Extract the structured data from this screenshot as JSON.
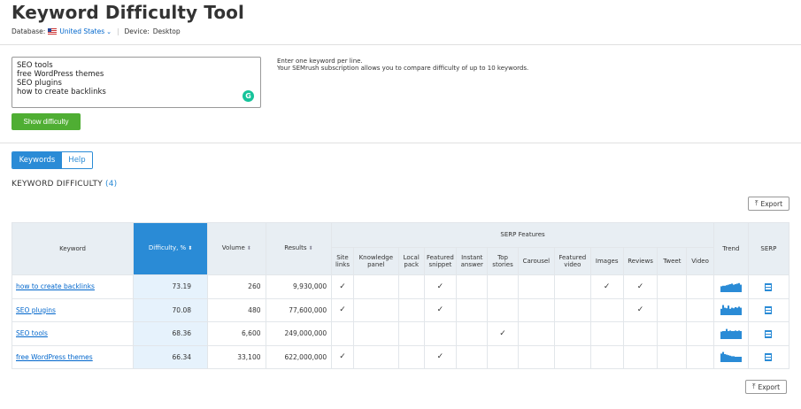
{
  "header": {
    "title": "Keyword Difficulty Tool",
    "database_label": "Database:",
    "database_value": "United States",
    "device_label": "Device:",
    "device_value": "Desktop"
  },
  "input": {
    "lines": [
      "SEO tools",
      "free WordPress themes",
      "SEO plugins",
      "how to create backlinks"
    ],
    "hint_line1": "Enter one keyword per line.",
    "hint_line2": "Your SEMrush subscription allows you to compare difficulty of up to 10 keywords.",
    "button_label": "Show difficulty",
    "grammarly_glyph": "G"
  },
  "tabs": [
    {
      "label": "Keywords",
      "active": true
    },
    {
      "label": "Help",
      "active": false
    }
  ],
  "section": {
    "title": "KEYWORD DIFFICULTY",
    "count": "(4)"
  },
  "export_label": "Export",
  "table": {
    "headers": {
      "keyword": "Keyword",
      "difficulty": "Difficulty, %",
      "volume": "Volume",
      "results": "Results",
      "serp_features": "SERP Features",
      "trend": "Trend",
      "serp": "SERP"
    },
    "features": [
      [
        "Site",
        "links"
      ],
      [
        "Knowledge",
        "panel"
      ],
      [
        "Local",
        "pack"
      ],
      [
        "Featured",
        "snippet"
      ],
      [
        "Instant",
        "answer"
      ],
      [
        "Top",
        "stories"
      ],
      [
        "Carousel"
      ],
      [
        "Featured",
        "video"
      ],
      [
        "Images"
      ],
      [
        "Reviews"
      ],
      [
        "Tweet"
      ],
      [
        "Video"
      ]
    ],
    "rows": [
      {
        "keyword": "how to create backlinks",
        "difficulty": "73.19",
        "volume": "260",
        "results": "9,930,000",
        "flags": [
          1,
          0,
          0,
          1,
          0,
          0,
          0,
          0,
          1,
          1,
          0,
          0
        ],
        "trend": [
          0.55,
          0.6,
          0.6,
          0.65,
          0.7,
          0.75,
          0.8,
          0.7,
          0.75,
          0.8,
          0.85,
          0.7
        ]
      },
      {
        "keyword": "SEO plugins",
        "difficulty": "70.08",
        "volume": "480",
        "results": "77,600,000",
        "flags": [
          1,
          0,
          0,
          1,
          0,
          0,
          0,
          0,
          0,
          1,
          0,
          0
        ],
        "trend": [
          0.6,
          0.95,
          0.7,
          0.65,
          0.9,
          0.6,
          0.7,
          0.65,
          0.75,
          0.7,
          0.8,
          0.7
        ]
      },
      {
        "keyword": "SEO tools",
        "difficulty": "68.36",
        "volume": "6,600",
        "results": "249,000,000",
        "flags": [
          0,
          0,
          0,
          0,
          0,
          1,
          0,
          0,
          0,
          0,
          0,
          0
        ],
        "trend": [
          0.7,
          0.75,
          0.75,
          0.95,
          0.75,
          0.8,
          0.75,
          0.75,
          0.8,
          0.75,
          0.8,
          0.75
        ]
      },
      {
        "keyword": "free WordPress themes",
        "difficulty": "66.34",
        "volume": "33,100",
        "results": "622,000,000",
        "flags": [
          1,
          0,
          0,
          1,
          0,
          0,
          0,
          0,
          0,
          0,
          0,
          0
        ],
        "trend": [
          0.8,
          0.95,
          0.75,
          0.7,
          0.65,
          0.6,
          0.55,
          0.55,
          0.5,
          0.5,
          0.5,
          0.5
        ]
      }
    ]
  },
  "colors": {
    "accent": "#2a8bd6",
    "button_green": "#4fae33",
    "header_bg": "#e8eef3",
    "difficulty_cell_bg": "#e6f2fc",
    "link": "#0066cc"
  },
  "check_glyph": "✓"
}
